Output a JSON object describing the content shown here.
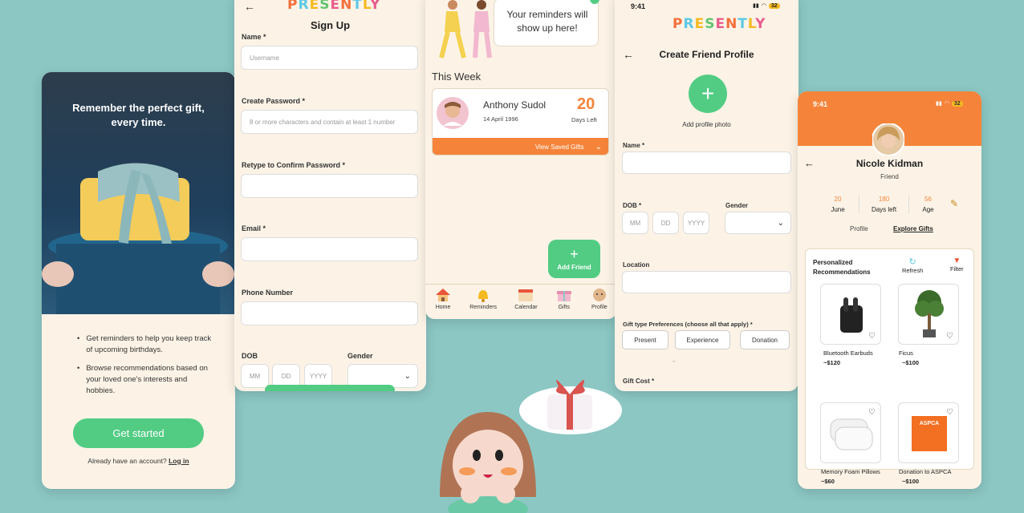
{
  "brand": {
    "logo_letters": [
      "P",
      "R",
      "E",
      "S",
      "E",
      "N",
      "T",
      "L",
      "Y"
    ]
  },
  "welcome": {
    "headline": "Remember the perfect gift, every time.",
    "bullet1": "Get reminders to help you keep track of upcoming birthdays.",
    "bullet2": "Browse recommendations based on your loved one's interests and hobbies.",
    "cta": "Get started",
    "account_prompt": "Already have an account?",
    "login_link": "Log in"
  },
  "signup": {
    "title": "Sign Up",
    "name_label": "Name *",
    "name_placeholder": "Username",
    "password_label": "Create Password *",
    "password_placeholder": "8 or more characters and contain at least 1 number",
    "confirm_label": "Retype to Confirm Password *",
    "email_label": "Email *",
    "phone_label": "Phone Number",
    "dob_label": "DOB",
    "gender_label": "Gender",
    "mm": "MM",
    "dd": "DD",
    "yyyy": "YYYY"
  },
  "home": {
    "reminder_text": "Your reminders will show up here!",
    "section_title": "This Week",
    "friend_name": "Anthony Sudol",
    "friend_date": "14 April 1996",
    "days_count": "20",
    "days_label": "Days Left",
    "view_saved": "View Saved Gifts",
    "add_friend": "Add Friend",
    "nav": [
      "Home",
      "Reminders",
      "Calendar",
      "Gifts",
      "Profile"
    ]
  },
  "create_friend": {
    "status_time": "9:41",
    "battery": "32",
    "title": "Create Friend Profile",
    "add_photo": "Add profile photo",
    "name_label": "Name *",
    "dob_label": "DOB *",
    "gender_label": "Gender",
    "mm": "MM",
    "dd": "DD",
    "yyyy": "YYYY",
    "location_label": "Location",
    "gift_type_label": "Gift type Preferences (choose all that apply) *",
    "gift_types": [
      "Present",
      "Experience",
      "Donation"
    ],
    "gift_cost_label": "Gift Cost *"
  },
  "profile": {
    "status_time": "9:41",
    "battery": "32",
    "name": "Nicole Kidman",
    "relation": "Friend",
    "stats": [
      {
        "value": "20",
        "label": "June"
      },
      {
        "value": "180",
        "label": "Days left"
      },
      {
        "value": "56",
        "label": "Age"
      }
    ],
    "tab_profile": "Profile",
    "tab_explore": "Explore Gifts",
    "rec_title": "Personalized Recommendations",
    "refresh": "Refresh",
    "filter": "Filter",
    "gifts": [
      {
        "name": "Bluetooth Earbuds",
        "price": "~$120"
      },
      {
        "name": "Ficus",
        "price": "~$100"
      },
      {
        "name": "Memory Foam Pillows",
        "price": "~$60"
      },
      {
        "name": "Donation to ASPCA",
        "price": "~$100"
      }
    ],
    "aspca_logo": "ASPCA"
  },
  "colors": {
    "background": "#8cc7c4",
    "screen": "#fcf3e6",
    "green": "#52cc83",
    "orange": "#f5843a"
  }
}
